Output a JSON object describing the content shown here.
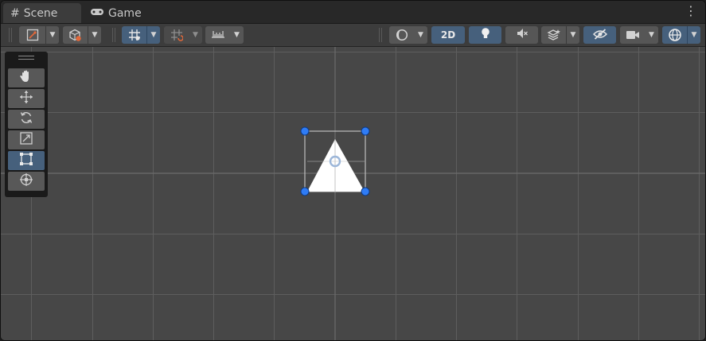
{
  "tabs": [
    {
      "label": "Scene",
      "icon": "hash-icon",
      "active": true
    },
    {
      "label": "Game",
      "icon": "gamepad-icon",
      "active": false
    }
  ],
  "toolbar": {
    "view_2d_label": "2D",
    "accent_color": "#46607c"
  },
  "tools": [
    {
      "name": "hand",
      "icon": "hand-icon",
      "active": false
    },
    {
      "name": "move",
      "icon": "move-icon",
      "active": false
    },
    {
      "name": "rotate",
      "icon": "rotate-icon",
      "active": false
    },
    {
      "name": "scale",
      "icon": "scale-icon",
      "active": false
    },
    {
      "name": "rect",
      "icon": "rect-transform-icon",
      "active": true
    },
    {
      "name": "transform",
      "icon": "transform-icon",
      "active": false
    }
  ],
  "scene": {
    "background_color": "#474747",
    "grid_color": "#5e5e5e",
    "selected_object": "triangle-sprite",
    "handle_color": "#2f7cf6"
  }
}
